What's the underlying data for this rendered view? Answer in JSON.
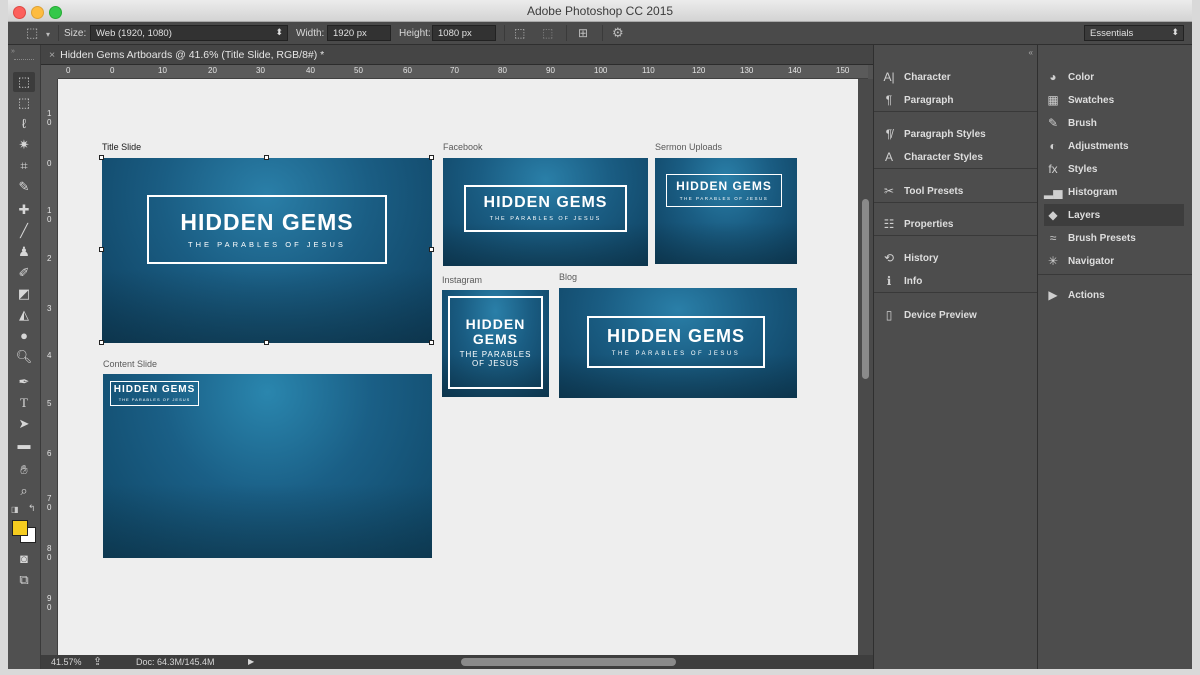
{
  "window": {
    "title": "Adobe Photoshop CC 2015"
  },
  "options_bar": {
    "size_label": "Size:",
    "size_value": "Web (1920, 1080)",
    "width_label": "Width:",
    "width_value": "1920 px",
    "height_label": "Height:",
    "height_value": "1080 px",
    "workspace": "Essentials"
  },
  "document": {
    "tab_close": "×",
    "tab_title": "Hidden Gems Artboards @ 41.6% (Title Slide, RGB/8#) *",
    "zoom": "41.57%",
    "doc_info": "Doc: 64.3M/145.4M"
  },
  "rulers": {
    "h_labels": [
      "0",
      "0",
      "10",
      "20",
      "30",
      "40",
      "50",
      "60",
      "70",
      "80",
      "90",
      "100",
      "110",
      "120",
      "130",
      "140",
      "150"
    ],
    "v_labels": [
      "1\n0",
      "0",
      "1\n0",
      "2",
      "3",
      "4",
      "5",
      "6",
      "7\n0",
      "8\n0",
      "9\n0"
    ]
  },
  "artboards": {
    "title_slide": {
      "label": "Title Slide",
      "title": "HIDDEN GEMS",
      "subtitle": "THE PARABLES OF JESUS"
    },
    "content_slide": {
      "label": "Content Slide",
      "title": "HIDDEN GEMS",
      "subtitle": "THE PARABLES OF JESUS"
    },
    "facebook": {
      "label": "Facebook",
      "title": "HIDDEN GEMS",
      "subtitle": "THE PARABLES OF JESUS"
    },
    "sermon_uploads": {
      "label": "Sermon Uploads",
      "title": "HIDDEN GEMS",
      "subtitle": "THE PARABLES OF JESUS"
    },
    "instagram": {
      "label": "Instagram",
      "title_line1": "HIDDEN",
      "title_line2": "GEMS",
      "subtitle_line1": "THE PARABLES",
      "subtitle_line2": "OF JESUS"
    },
    "blog": {
      "label": "Blog",
      "title": "HIDDEN GEMS",
      "subtitle": "THE PARABLES OF JESUS"
    }
  },
  "panels_left": [
    {
      "label": "Character",
      "icon": "character-icon"
    },
    {
      "label": "Paragraph",
      "icon": "paragraph-icon"
    },
    {
      "label": "Paragraph Styles",
      "icon": "paragraph-styles-icon"
    },
    {
      "label": "Character Styles",
      "icon": "character-styles-icon"
    },
    {
      "label": "Tool Presets",
      "icon": "tool-presets-icon"
    },
    {
      "label": "Properties",
      "icon": "properties-icon"
    },
    {
      "label": "History",
      "icon": "history-icon"
    },
    {
      "label": "Info",
      "icon": "info-icon"
    },
    {
      "label": "Device Preview",
      "icon": "device-preview-icon"
    }
  ],
  "panels_right": [
    {
      "label": "Color",
      "icon": "color-icon"
    },
    {
      "label": "Swatches",
      "icon": "swatches-icon"
    },
    {
      "label": "Brush",
      "icon": "brush-icon"
    },
    {
      "label": "Adjustments",
      "icon": "adjustments-icon"
    },
    {
      "label": "Styles",
      "icon": "styles-icon"
    },
    {
      "label": "Histogram",
      "icon": "histogram-icon"
    },
    {
      "label": "Layers",
      "icon": "layers-icon",
      "active": true
    },
    {
      "label": "Brush Presets",
      "icon": "brush-presets-icon"
    },
    {
      "label": "Navigator",
      "icon": "navigator-icon"
    },
    {
      "label": "Actions",
      "icon": "actions-icon"
    }
  ],
  "colors": {
    "foreground": "#f5cc1f",
    "background": "#ffffff",
    "artboard_blue": "#1a5d83"
  }
}
